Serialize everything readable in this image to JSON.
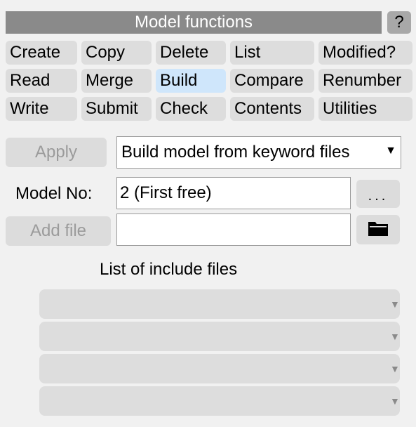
{
  "header": {
    "title": "Model functions",
    "help_label": "?"
  },
  "tabs": {
    "row1": [
      "Create",
      "Copy",
      "Delete",
      "List",
      "Modified?"
    ],
    "row2": [
      "Read",
      "Merge",
      "Build",
      "Compare",
      "Renumber"
    ],
    "row3": [
      "Write",
      "Submit",
      "Check",
      "Contents",
      "Utilities"
    ],
    "active": "Build"
  },
  "apply_label": "Apply",
  "mode_select": {
    "value": "Build model from keyword files",
    "arrow": "▼"
  },
  "model_no": {
    "label": "Model No:",
    "value": "2 (First free)",
    "dots_label": "..."
  },
  "add_file": {
    "label": "Add file",
    "value": "",
    "icon": "folder-icon"
  },
  "include_list": {
    "heading": "List of include files",
    "rows": [
      "",
      "",
      "",
      ""
    ],
    "arrow": "▼"
  },
  "colors": {
    "title_bg": "#8a8a8a",
    "tab_bg": "#dddddd",
    "active_tab_bg": "#cfe6fb",
    "panel_bg": "#f1f1f1"
  }
}
